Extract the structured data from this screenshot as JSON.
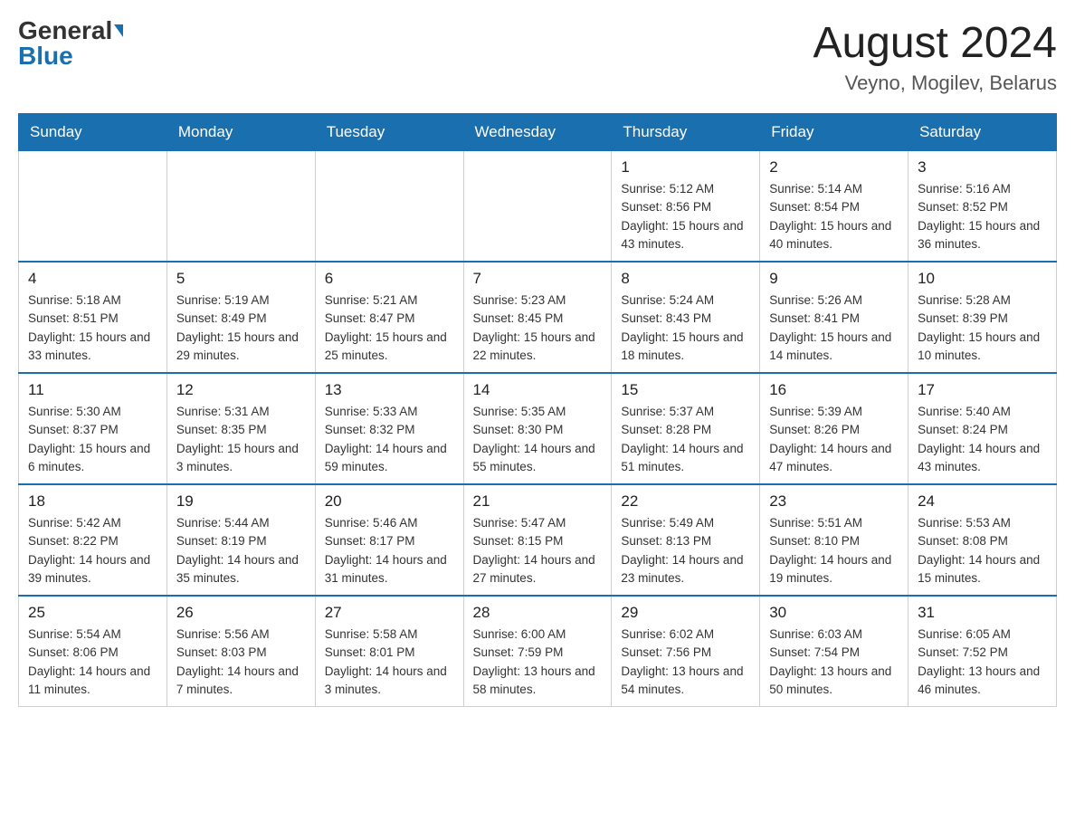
{
  "logo": {
    "general": "General",
    "blue": "Blue"
  },
  "title": "August 2024",
  "subtitle": "Veyno, Mogilev, Belarus",
  "days_of_week": [
    "Sunday",
    "Monday",
    "Tuesday",
    "Wednesday",
    "Thursday",
    "Friday",
    "Saturday"
  ],
  "weeks": [
    [
      {
        "day": "",
        "info": ""
      },
      {
        "day": "",
        "info": ""
      },
      {
        "day": "",
        "info": ""
      },
      {
        "day": "",
        "info": ""
      },
      {
        "day": "1",
        "info": "Sunrise: 5:12 AM\nSunset: 8:56 PM\nDaylight: 15 hours and 43 minutes."
      },
      {
        "day": "2",
        "info": "Sunrise: 5:14 AM\nSunset: 8:54 PM\nDaylight: 15 hours and 40 minutes."
      },
      {
        "day": "3",
        "info": "Sunrise: 5:16 AM\nSunset: 8:52 PM\nDaylight: 15 hours and 36 minutes."
      }
    ],
    [
      {
        "day": "4",
        "info": "Sunrise: 5:18 AM\nSunset: 8:51 PM\nDaylight: 15 hours and 33 minutes."
      },
      {
        "day": "5",
        "info": "Sunrise: 5:19 AM\nSunset: 8:49 PM\nDaylight: 15 hours and 29 minutes."
      },
      {
        "day": "6",
        "info": "Sunrise: 5:21 AM\nSunset: 8:47 PM\nDaylight: 15 hours and 25 minutes."
      },
      {
        "day": "7",
        "info": "Sunrise: 5:23 AM\nSunset: 8:45 PM\nDaylight: 15 hours and 22 minutes."
      },
      {
        "day": "8",
        "info": "Sunrise: 5:24 AM\nSunset: 8:43 PM\nDaylight: 15 hours and 18 minutes."
      },
      {
        "day": "9",
        "info": "Sunrise: 5:26 AM\nSunset: 8:41 PM\nDaylight: 15 hours and 14 minutes."
      },
      {
        "day": "10",
        "info": "Sunrise: 5:28 AM\nSunset: 8:39 PM\nDaylight: 15 hours and 10 minutes."
      }
    ],
    [
      {
        "day": "11",
        "info": "Sunrise: 5:30 AM\nSunset: 8:37 PM\nDaylight: 15 hours and 6 minutes."
      },
      {
        "day": "12",
        "info": "Sunrise: 5:31 AM\nSunset: 8:35 PM\nDaylight: 15 hours and 3 minutes."
      },
      {
        "day": "13",
        "info": "Sunrise: 5:33 AM\nSunset: 8:32 PM\nDaylight: 14 hours and 59 minutes."
      },
      {
        "day": "14",
        "info": "Sunrise: 5:35 AM\nSunset: 8:30 PM\nDaylight: 14 hours and 55 minutes."
      },
      {
        "day": "15",
        "info": "Sunrise: 5:37 AM\nSunset: 8:28 PM\nDaylight: 14 hours and 51 minutes."
      },
      {
        "day": "16",
        "info": "Sunrise: 5:39 AM\nSunset: 8:26 PM\nDaylight: 14 hours and 47 minutes."
      },
      {
        "day": "17",
        "info": "Sunrise: 5:40 AM\nSunset: 8:24 PM\nDaylight: 14 hours and 43 minutes."
      }
    ],
    [
      {
        "day": "18",
        "info": "Sunrise: 5:42 AM\nSunset: 8:22 PM\nDaylight: 14 hours and 39 minutes."
      },
      {
        "day": "19",
        "info": "Sunrise: 5:44 AM\nSunset: 8:19 PM\nDaylight: 14 hours and 35 minutes."
      },
      {
        "day": "20",
        "info": "Sunrise: 5:46 AM\nSunset: 8:17 PM\nDaylight: 14 hours and 31 minutes."
      },
      {
        "day": "21",
        "info": "Sunrise: 5:47 AM\nSunset: 8:15 PM\nDaylight: 14 hours and 27 minutes."
      },
      {
        "day": "22",
        "info": "Sunrise: 5:49 AM\nSunset: 8:13 PM\nDaylight: 14 hours and 23 minutes."
      },
      {
        "day": "23",
        "info": "Sunrise: 5:51 AM\nSunset: 8:10 PM\nDaylight: 14 hours and 19 minutes."
      },
      {
        "day": "24",
        "info": "Sunrise: 5:53 AM\nSunset: 8:08 PM\nDaylight: 14 hours and 15 minutes."
      }
    ],
    [
      {
        "day": "25",
        "info": "Sunrise: 5:54 AM\nSunset: 8:06 PM\nDaylight: 14 hours and 11 minutes."
      },
      {
        "day": "26",
        "info": "Sunrise: 5:56 AM\nSunset: 8:03 PM\nDaylight: 14 hours and 7 minutes."
      },
      {
        "day": "27",
        "info": "Sunrise: 5:58 AM\nSunset: 8:01 PM\nDaylight: 14 hours and 3 minutes."
      },
      {
        "day": "28",
        "info": "Sunrise: 6:00 AM\nSunset: 7:59 PM\nDaylight: 13 hours and 58 minutes."
      },
      {
        "day": "29",
        "info": "Sunrise: 6:02 AM\nSunset: 7:56 PM\nDaylight: 13 hours and 54 minutes."
      },
      {
        "day": "30",
        "info": "Sunrise: 6:03 AM\nSunset: 7:54 PM\nDaylight: 13 hours and 50 minutes."
      },
      {
        "day": "31",
        "info": "Sunrise: 6:05 AM\nSunset: 7:52 PM\nDaylight: 13 hours and 46 minutes."
      }
    ]
  ]
}
